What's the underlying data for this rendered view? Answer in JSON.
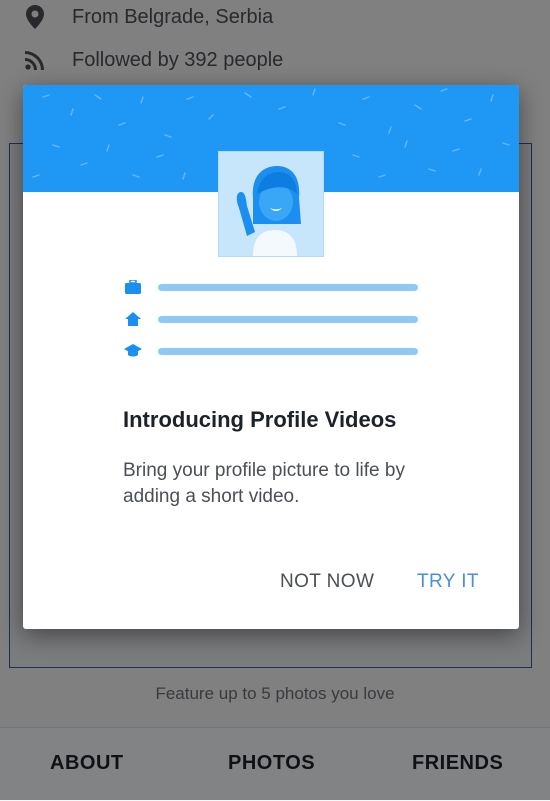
{
  "profile_info": {
    "hometown": "From Belgrade, Serbia",
    "followers": "Followed by 392 people"
  },
  "featured": {
    "caption": "Feature up to 5 photos you love"
  },
  "tabs": [
    {
      "label": "ABOUT"
    },
    {
      "label": "PHOTOS"
    },
    {
      "label": "FRIENDS"
    }
  ],
  "dialog": {
    "title": "Introducing Profile Videos",
    "body": "Bring your profile picture to life by adding a short video.",
    "not_now_label": "NOT NOW",
    "try_it_label": "TRY IT",
    "icons": [
      "briefcase-icon",
      "home-icon",
      "graduation-cap-icon"
    ]
  },
  "colors": {
    "banner": "#1e98f4",
    "accent": "#4a90d9",
    "placeholder_line": "#8ec9f5"
  }
}
